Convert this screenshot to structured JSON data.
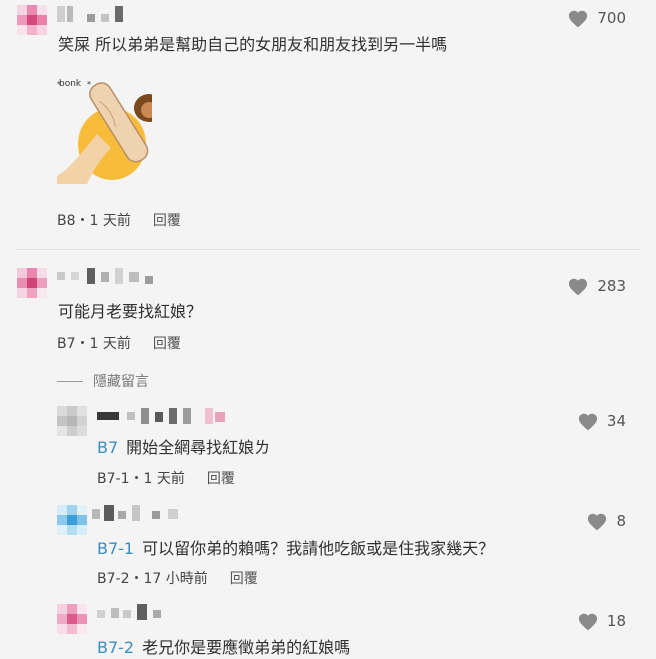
{
  "comments": [
    {
      "likes": "700",
      "text": "笑屎 所以弟弟是幫助自己的女朋友和朋友找到另一半嗎",
      "meta": "B8・1 天前",
      "reply_label": "回覆",
      "sticker_text": "bonk"
    },
    {
      "likes": "283",
      "text": "可能月老要找紅娘？",
      "meta": "B7・1 天前",
      "reply_label": "回覆"
    }
  ],
  "hide_replies_label": "隱藏留言",
  "replies": [
    {
      "likes": "34",
      "ref": "B7",
      "text": "開始全網尋找紅娘ㄌ",
      "meta": "B7-1・1 天前",
      "reply_label": "回覆"
    },
    {
      "likes": "8",
      "ref": "B7-1",
      "text": "可以留你弟的賴嗎？我請他吃飯或是住我家幾天？",
      "meta": "B7-2・17 小時前",
      "reply_label": "回覆"
    },
    {
      "likes": "18",
      "ref": "B7-2",
      "text": "老兄你是要應徵弟弟的紅娘嗎"
    }
  ],
  "colors": {
    "background": "#f4f4f4",
    "reference_blue": "#3a8dc4",
    "heart_gray": "#8a8a8a"
  },
  "icons": [
    "heart-icon"
  ]
}
